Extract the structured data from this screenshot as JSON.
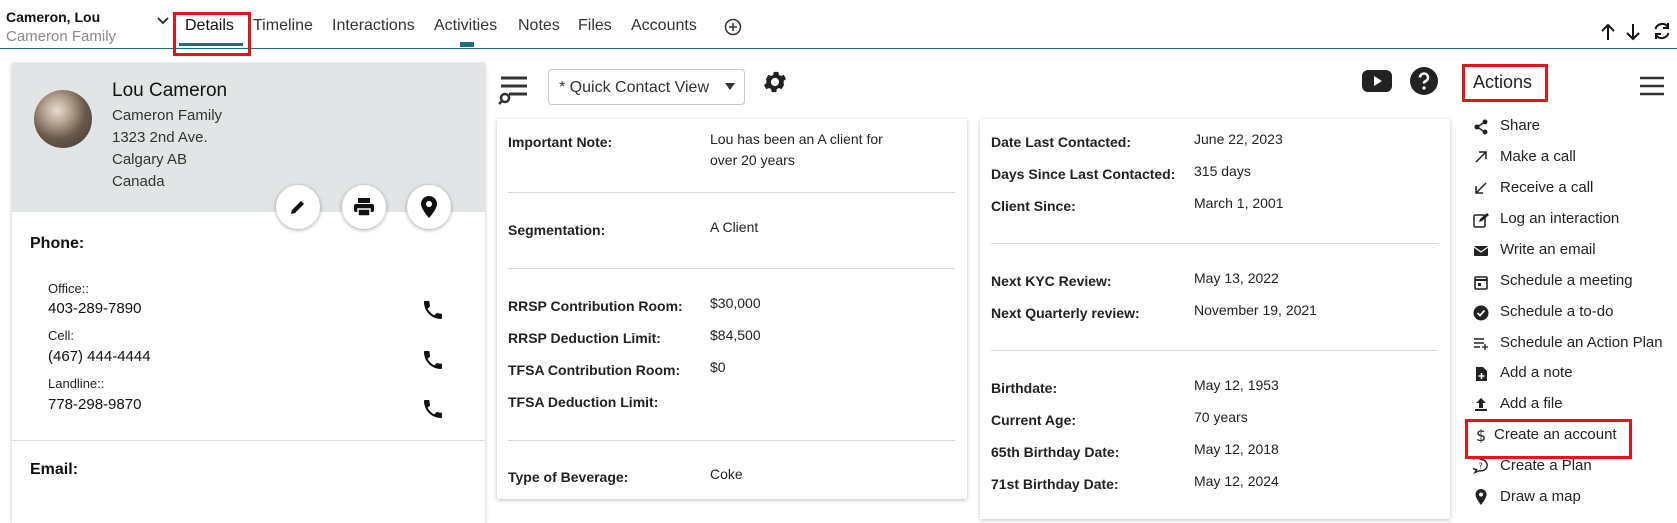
{
  "header": {
    "contact_name": "Cameron, Lou",
    "household": "Cameron Family",
    "tabs": [
      "Details",
      "Timeline",
      "Interactions",
      "Activities",
      "Notes",
      "Files",
      "Accounts"
    ]
  },
  "profile": {
    "name": "Lou Cameron",
    "household": "Cameron Family",
    "address1": "1323 2nd Ave.",
    "address2": "Calgary AB",
    "country": "Canada",
    "phone_section": "Phone:",
    "email_section": "Email:",
    "phones": [
      {
        "label": "Office::",
        "value": "403-289-7890"
      },
      {
        "label": "Cell:",
        "value": "(467) 444-4444"
      },
      {
        "label": "Landline::",
        "value": "778-298-9870"
      }
    ]
  },
  "view": {
    "selected": "* Quick Contact View"
  },
  "fields_left": {
    "important_note_label": "Important Note:",
    "important_note_line1": "Lou has been an A client for",
    "important_note_line2": "over 20 years",
    "segmentation_label": "Segmentation:",
    "segmentation_value": "A Client",
    "rrsp_room_label": "RRSP Contribution Room:",
    "rrsp_room_value": "$30,000",
    "rrsp_deduct_label": "RRSP Deduction Limit:",
    "rrsp_deduct_value": "$84,500",
    "tfsa_room_label": "TFSA Contribution Room:",
    "tfsa_room_value": "$0",
    "tfsa_deduct_label": "TFSA Deduction Limit:",
    "beverage_label": "Type of Beverage:",
    "beverage_value": "Coke"
  },
  "fields_right": {
    "last_contacted_label": "Date Last Contacted:",
    "last_contacted_value": "June 22, 2023",
    "days_since_label": "Days Since Last Contacted:",
    "days_since_value": "315 days",
    "client_since_label": "Client Since:",
    "client_since_value": "March 1, 2001",
    "kyc_label": "Next KYC Review:",
    "kyc_value": "May 13, 2022",
    "quarterly_label": "Next Quarterly review:",
    "quarterly_value": "November 19, 2021",
    "birthdate_label": "Birthdate:",
    "birthdate_value": "May 12, 1953",
    "age_label": "Current Age:",
    "age_value": "70 years",
    "bday65_label": "65th Birthday Date:",
    "bday65_value": "May 12, 2018",
    "bday71_label": "71st Birthday Date:",
    "bday71_value": "May 12, 2024"
  },
  "actions": {
    "title": "Actions",
    "items": [
      "Share",
      "Make a call",
      "Receive a call",
      "Log an interaction",
      "Write an email",
      "Schedule a meeting",
      "Schedule a to-do",
      "Schedule an Action Plan",
      "Add a note",
      "Add a file",
      "Create an account",
      "Create a Plan",
      "Draw a map"
    ]
  },
  "icons": [
    "chevron-down-icon",
    "add-circle-icon",
    "arrow-up-icon",
    "arrow-down-icon",
    "refresh-icon",
    "edit-icon",
    "print-icon",
    "location-icon",
    "phone-icon",
    "filter-search-icon",
    "gear-icon",
    "youtube-icon",
    "help-icon",
    "menu-icon"
  ],
  "colors": {
    "accent": "#1c6e7d",
    "highlight": "#e0161e",
    "header_bg": "#e1e5e6"
  }
}
